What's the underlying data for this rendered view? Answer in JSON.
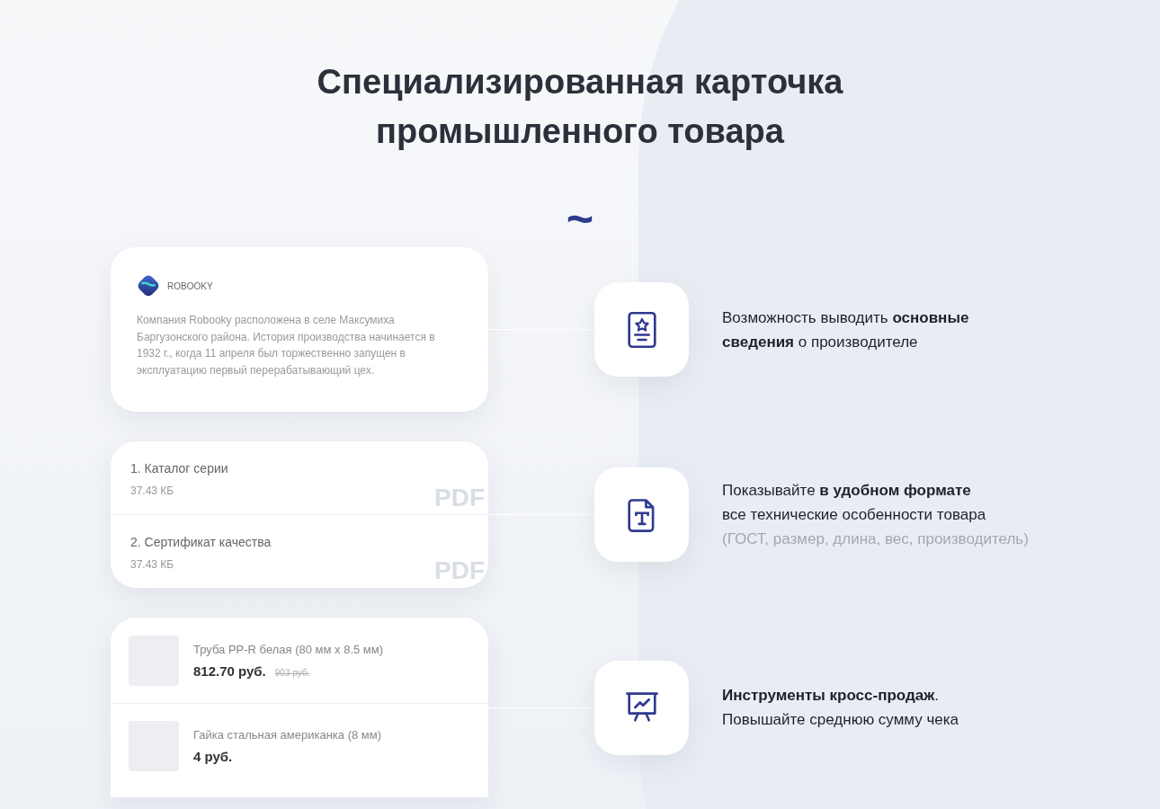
{
  "title": "Специализированная карточка промышленного товара",
  "divider": "~",
  "features": [
    {
      "kind": "company",
      "card": {
        "company_name": "ROBOOKY",
        "description": "Компания Robooky расположена в селе Максумиха Баргузонского района. История производства начинается в 1932 г., когда 11 апреля был торжественно запущен в эксплуатацию первый перерабатывающий цех."
      },
      "lines": [
        "Возможность выводить **основные**",
        "**сведения** о производителе"
      ]
    },
    {
      "kind": "documents",
      "card": {
        "files": [
          {
            "name": "1. Каталог серии",
            "size": "37.43 КБ",
            "format": "PDF"
          },
          {
            "name": "2. Сертификат качества",
            "size": "37.43 КБ",
            "format": "PDF"
          }
        ]
      },
      "lines": [
        "Показывайте **в удобном формате**",
        "все технические особенности товара"
      ],
      "note": "(ГОСТ, размер, длина, вес, производитель)"
    },
    {
      "kind": "products",
      "card": {
        "products": [
          {
            "name": "Труба PP-R белая (80 мм x 8.5 мм)",
            "price": "812.70 руб.",
            "old_price": "903 руб."
          },
          {
            "name": "Гайка стальная американка (8 мм)",
            "price": "4 руб."
          }
        ]
      },
      "lines": [
        "**Инструменты кросс-продаж**.",
        "Повышайте среднюю сумму чека"
      ]
    }
  ]
}
